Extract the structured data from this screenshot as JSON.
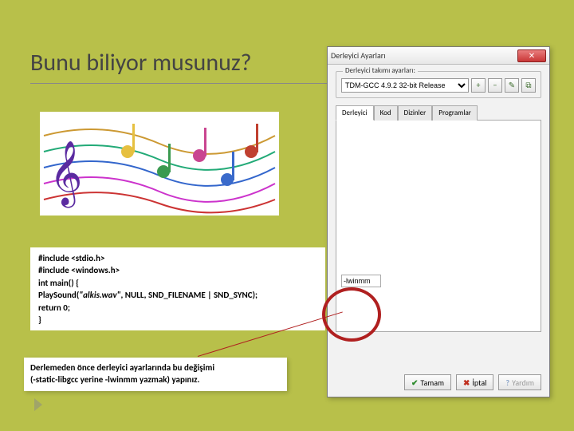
{
  "title": "Bunu biliyor musunuz?",
  "code": {
    "l1": "#include <stdio.h>",
    "l2": "#include <windows.h>",
    "l3": "int main() {",
    "l4a": "PlaySound(",
    "l4b": "\"alkis.wav\"",
    "l4c": ", NULL, SND_FILENAME | SND_SYNC);",
    "l5": "return 0;",
    "l6": "}"
  },
  "note": {
    "line1": "Derlemeden önce derleyici ayarlarında bu değişimi",
    "line2": "(-static-libgcc yerine -lwinmm yazmak) yapınız."
  },
  "dialog": {
    "title": "Derleyici Ayarları",
    "group_label": "Derleyici takımı ayarları:",
    "compiler_selected": "TDM-GCC 4.9.2 32-bit Release",
    "tabs": [
      "Derleyici",
      "Kod",
      "Dizinler",
      "Programlar"
    ],
    "linker_value": "-lwinmm",
    "buttons": {
      "ok": "Tamam",
      "cancel": "İptal",
      "help": "Yardım"
    },
    "mini": {
      "add": "+",
      "del": "−",
      "rename": "✎",
      "dup": "⧉"
    }
  }
}
